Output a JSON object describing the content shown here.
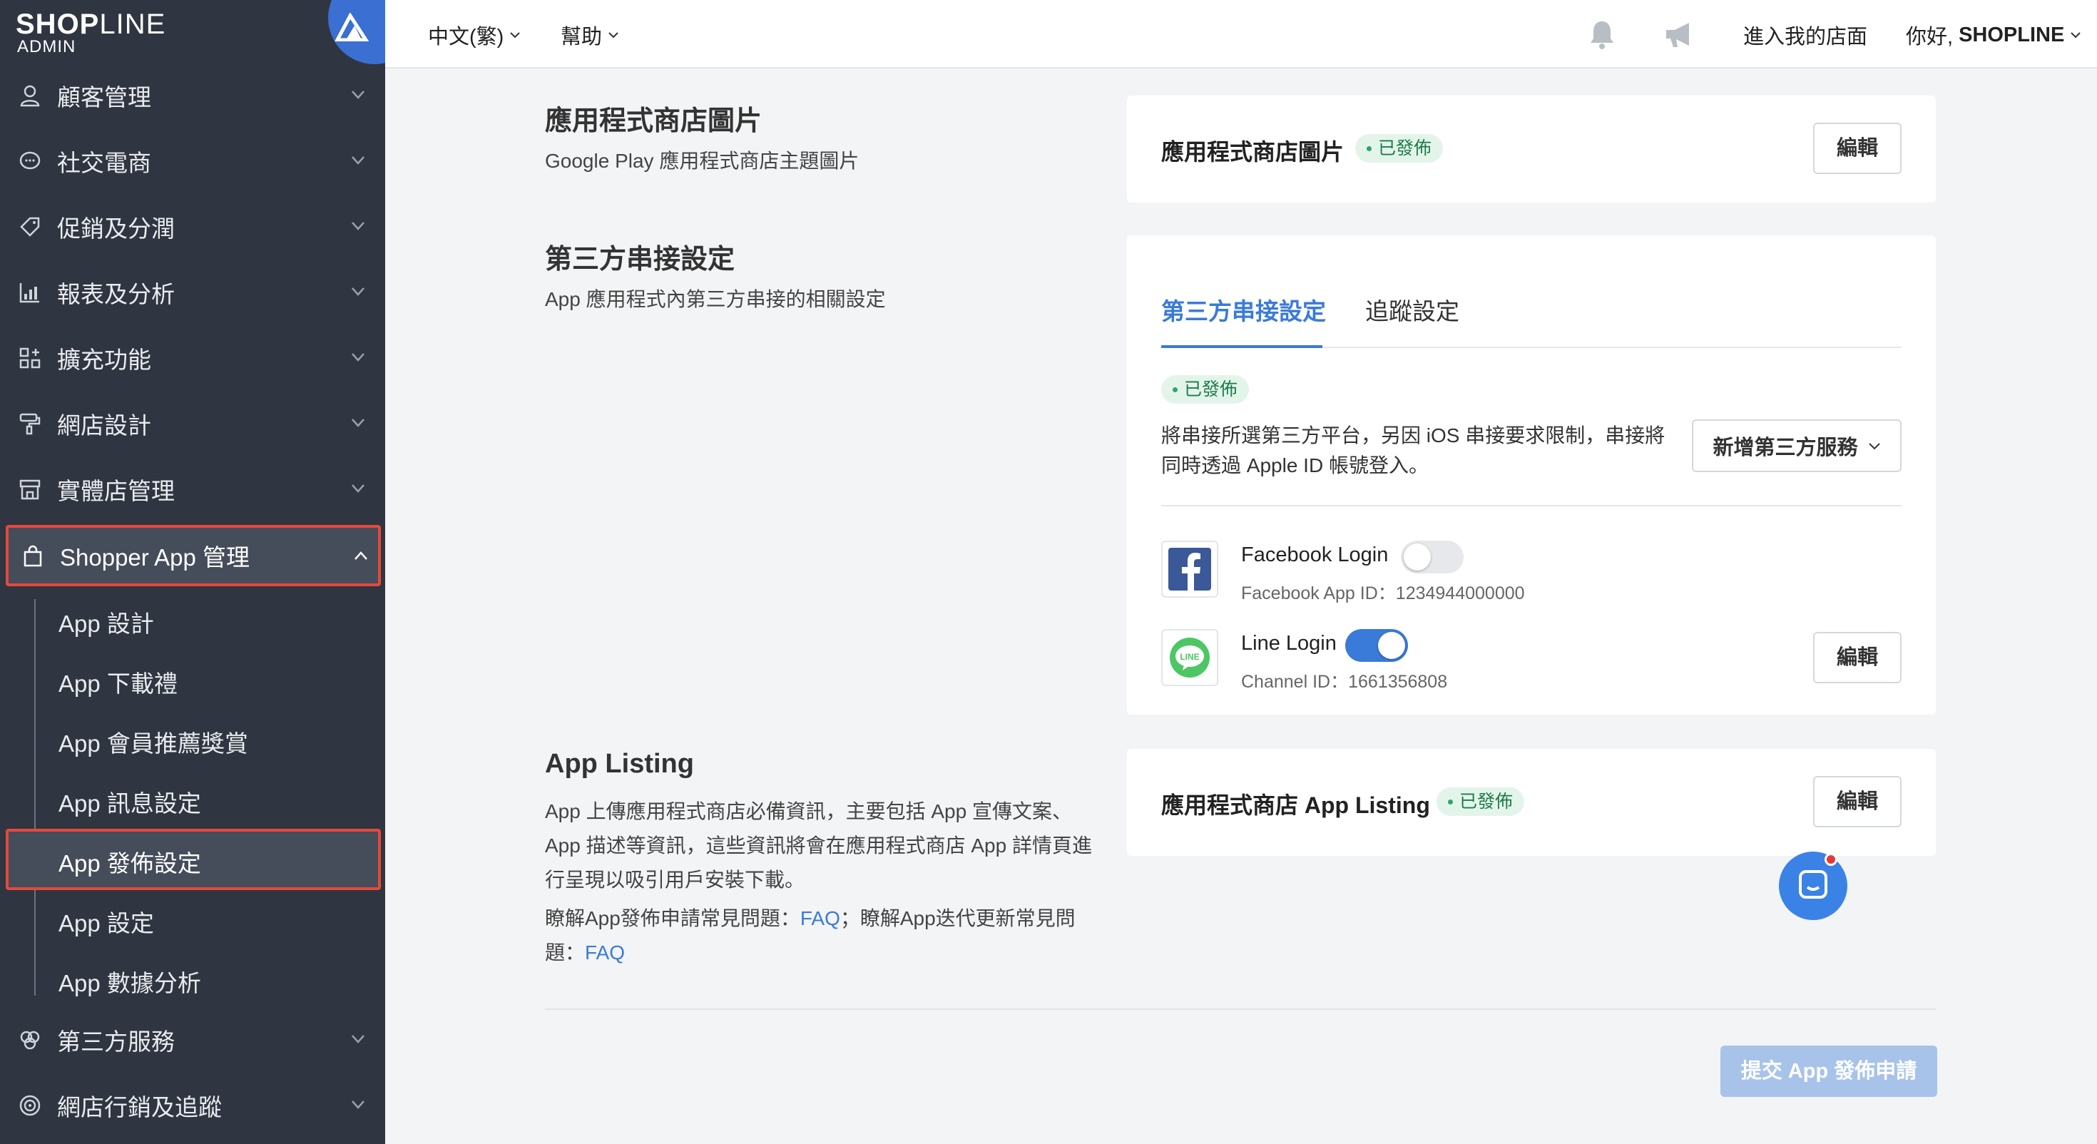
{
  "brand": {
    "name_bold": "SHOP",
    "name_light": "LINE",
    "sub": "ADMIN"
  },
  "sidebar": {
    "items": [
      {
        "label": "顧客管理",
        "icon": "user-icon"
      },
      {
        "label": "社交電商",
        "icon": "chat-icon"
      },
      {
        "label": "促銷及分潤",
        "icon": "tag-icon"
      },
      {
        "label": "報表及分析",
        "icon": "chart-icon"
      },
      {
        "label": "擴充功能",
        "icon": "apps-icon"
      },
      {
        "label": "網店設計",
        "icon": "paint-roller-icon"
      },
      {
        "label": "實體店管理",
        "icon": "store-icon"
      },
      {
        "label": "Shopper App 管理",
        "icon": "shopping-bag-icon"
      }
    ],
    "sub_items": [
      {
        "label": "App 設計"
      },
      {
        "label": "App 下載禮"
      },
      {
        "label": "App 會員推薦獎賞"
      },
      {
        "label": "App 訊息設定"
      },
      {
        "label": "App 發佈設定"
      },
      {
        "label": "App 設定"
      },
      {
        "label": "App 數據分析"
      }
    ],
    "bottom_items": [
      {
        "label": "第三方服務",
        "icon": "integrations-icon"
      },
      {
        "label": "網店行銷及追蹤",
        "icon": "target-icon"
      }
    ]
  },
  "topbar": {
    "language": "中文(繁)",
    "help": "幫助",
    "store_link": "進入我的店面",
    "greeting_prefix": "你好, ",
    "greeting_name": "SHOPLINE"
  },
  "sections": {
    "store_images": {
      "title": "應用程式商店圖片",
      "desc": "Google Play 應用程式商店主題圖片",
      "card_title": "應用程式商店圖片",
      "status": "已發佈",
      "edit": "編輯"
    },
    "third_party": {
      "title": "第三方串接設定",
      "desc": "App 應用程式內第三方串接的相關設定",
      "tabs": [
        "第三方串接設定",
        "追蹤設定"
      ],
      "status": "已發佈",
      "note_line1": "將串接所選第三方平台，另因 iOS 串接要求限制，串接將",
      "note_line2": "同時透過 Apple ID 帳號登入。",
      "add_button": "新增第三方服務",
      "facebook": {
        "name": "Facebook Login",
        "sub": "Facebook App ID：1234944000000",
        "enabled": false
      },
      "line": {
        "name": "Line Login",
        "sub": "Channel ID：1661356808",
        "enabled": true,
        "logo_text": "LINE"
      },
      "edit": "編輯"
    },
    "app_listing": {
      "title": "App Listing",
      "desc_line1": "App 上傳應用程式商店必備資訊，主要包括 App 宣傳文案、",
      "desc_line2": "App 描述等資訊，這些資訊將會在應用程式商店 App 詳情頁進",
      "desc_line3": "行呈現以吸引用戶安裝下載。",
      "faq_prefix": "瞭解App發佈申請常見問題：",
      "faq_link1": "FAQ",
      "faq_middle": "；瞭解App迭代更新常見問",
      "faq_line2_prefix": "題：",
      "faq_link2": "FAQ",
      "card_title": "應用程式商店 App Listing",
      "status": "已發佈",
      "edit": "編輯"
    }
  },
  "footer": {
    "submit": "提交 App 發佈申請"
  },
  "colors": {
    "accent": "#3a7ad9",
    "sidebar_bg": "#2f3541",
    "highlight_border": "#e5493a",
    "badge_bg": "#e3f5ea"
  }
}
